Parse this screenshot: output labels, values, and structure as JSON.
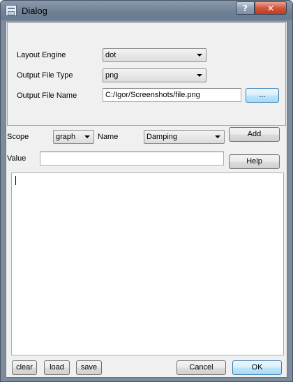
{
  "window": {
    "title": "Dialog",
    "help_glyph": "?",
    "close_glyph": "✕"
  },
  "settings": {
    "layout_engine_label": "Layout Engine",
    "layout_engine_value": "dot",
    "output_type_label": "Output File Type",
    "output_type_value": "png",
    "output_name_label": "Output File Name",
    "output_name_value": "C:/Igor/Screenshots/file.png",
    "browse_label": "..."
  },
  "attributes": {
    "scope_label": "Scope",
    "scope_value": "graph",
    "name_label": "Name",
    "name_value": "Damping",
    "add_label": "Add",
    "value_label": "Value",
    "value_value": "",
    "help_label": "Help"
  },
  "editor": {
    "content": ""
  },
  "footer": {
    "clear_label": "clear",
    "load_label": "load",
    "save_label": "save",
    "cancel_label": "Cancel",
    "ok_label": "OK"
  },
  "colors": {
    "frame": "#7c8c9f",
    "client_bg": "#f0f0f0",
    "close_button": "#c13b20",
    "default_button_border": "#3c7fb1"
  },
  "icons": {
    "app": "dialog-app-icon",
    "help": "question-mark-icon",
    "close": "close-x-icon",
    "dropdown": "chevron-down-icon"
  }
}
